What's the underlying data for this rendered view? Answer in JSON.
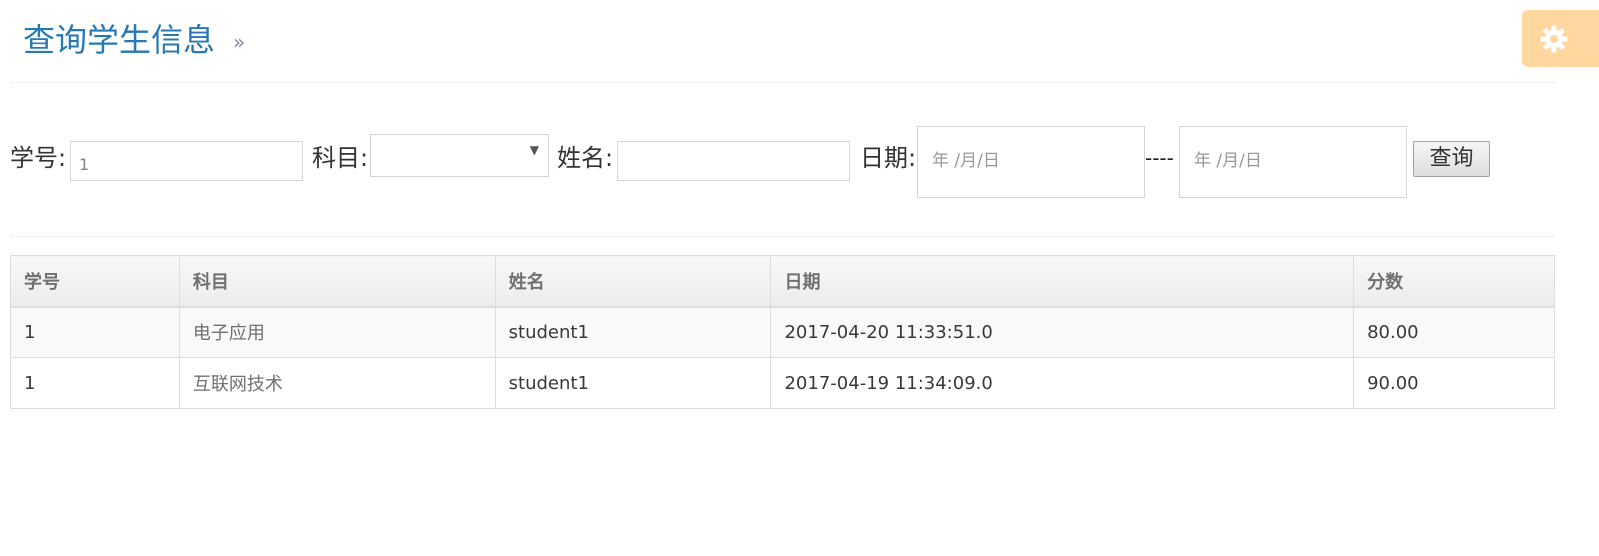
{
  "header": {
    "title": "查询学生信息",
    "chevron": "»",
    "settings_icon": "gear-icon",
    "settings_color": "#ffb752"
  },
  "form": {
    "id_label": "学号:",
    "id_value": "1",
    "subject_label": "科目:",
    "subject_selected": "",
    "name_label": "姓名:",
    "name_value": "",
    "date_label": "日期:",
    "date_start_placeholder": "年 /月/日",
    "date_separator": "----",
    "date_end_placeholder": "年 /月/日",
    "submit_label": "查询"
  },
  "table": {
    "headers": [
      "学号",
      "科目",
      "姓名",
      "日期",
      "分数"
    ],
    "rows": [
      [
        "1",
        "电子应用",
        "student1",
        "2017-04-20 11:33:51.0",
        "80.00"
      ],
      [
        "1",
        "互联网技术",
        "student1",
        "2017-04-19 11:34:09.0",
        "90.00"
      ]
    ]
  },
  "colors": {
    "title": "#2679b5",
    "border": "#dddddd"
  }
}
